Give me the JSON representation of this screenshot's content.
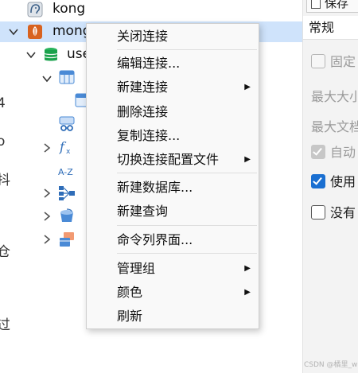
{
  "left_edge": {
    "chars": [
      "4",
      "o",
      "抖",
      "仓",
      "过"
    ]
  },
  "tree": {
    "top_connection": {
      "label": "kong",
      "icon": "postgresql-elephant-icon"
    },
    "selected_connection": {
      "label": "mong",
      "icon": "mongodb-leaf-icon"
    },
    "database": {
      "label": "use",
      "icon": "database-cylinder-icon"
    }
  },
  "context_menu": {
    "items": [
      {
        "label": "关闭连接",
        "submenu": false
      },
      {
        "label": "编辑连接...",
        "submenu": false
      },
      {
        "label": "新建连接",
        "submenu": true
      },
      {
        "label": "删除连接",
        "submenu": false
      },
      {
        "label": "复制连接...",
        "submenu": false
      },
      {
        "label": "切换连接配置文件",
        "submenu": true
      },
      {
        "label": "新建数据库...",
        "submenu": false
      },
      {
        "label": "新建查询",
        "submenu": false
      },
      {
        "label": "命令列界面...",
        "submenu": false
      },
      {
        "label": "管理组",
        "submenu": true
      },
      {
        "label": "颜色",
        "submenu": true
      },
      {
        "label": "刷新",
        "submenu": false
      }
    ],
    "submenu_arrow": "▶"
  },
  "right_panel": {
    "save_label": "保存",
    "tab_label": "常规",
    "rows": [
      {
        "label": "固定"
      },
      {
        "label": "最大大小"
      },
      {
        "label": "最大文档"
      },
      {
        "label": "自动"
      },
      {
        "label": "使用"
      },
      {
        "label": "没有"
      }
    ]
  },
  "watermark": "CSDN @橘里_w",
  "colors": {
    "selection": "#cfe3fb",
    "accent": "#1a6fd1",
    "mongodb_orange": "#d8621f",
    "db_green": "#1aa24c"
  }
}
